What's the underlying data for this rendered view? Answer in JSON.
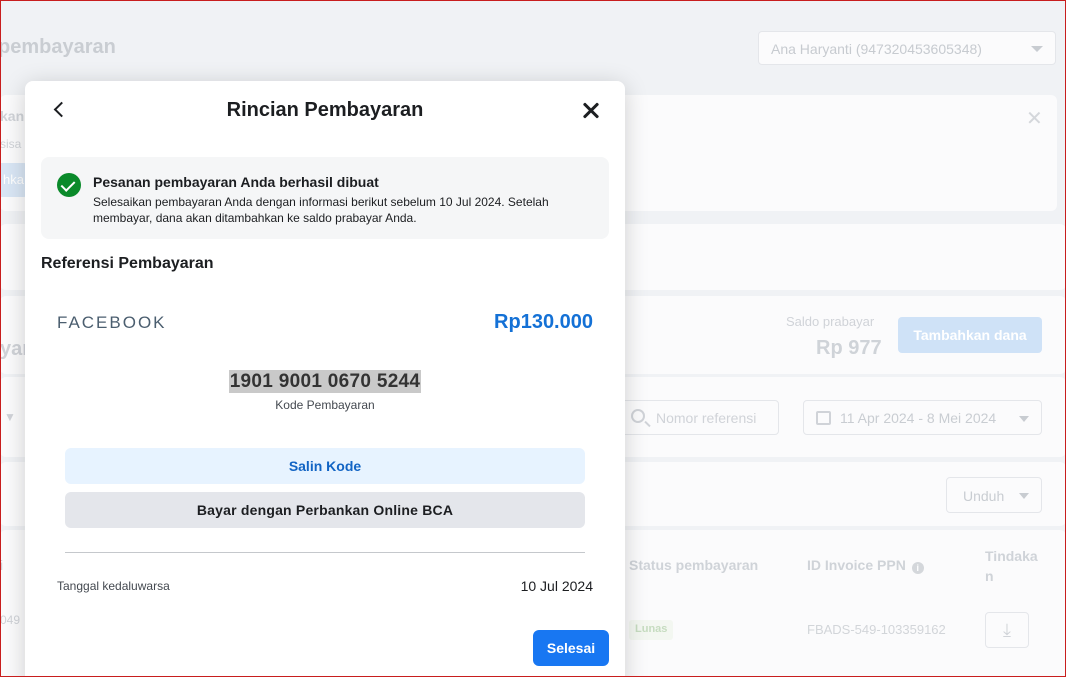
{
  "background": {
    "page_title": "pembayaran",
    "account_select": "Ana Haryanti (947320453605348)",
    "fragments": {
      "left1": "kan",
      "left2": "sisa",
      "left_btn": "hka",
      "left_heading": "yan"
    },
    "balance": {
      "label": "Saldo prabayar",
      "value": "Rp 977",
      "add_funds_label": "Tambahkan dana"
    },
    "search": {
      "placeholder": "Nomor referensi"
    },
    "date_range": "11 Apr 2024 - 8 Mei 2024",
    "download_label": "Unduh",
    "table": {
      "columns": [
        "Status pembayaran",
        "ID Invoice PPN",
        "Tindakan"
      ],
      "row": {
        "id_fragment": "049",
        "status": "Lunas",
        "invoice_id": "FBADS-549-103359162"
      }
    }
  },
  "modal": {
    "title": "Rincian Pembayaran",
    "success": {
      "title": "Pesanan pembayaran Anda berhasil dibuat",
      "message": "Selesaikan pembayaran Anda dengan informasi berikut sebelum 10 Jul 2024. Setelah membayar, dana akan ditambahkan ke saldo prabayar Anda."
    },
    "reference_heading": "Referensi Pembayaran",
    "brand": "FACEBOOK",
    "amount": "Rp130.000",
    "payment_code": "1901 9001 0670 5244",
    "payment_code_label": "Kode Pembayaran",
    "copy_button": "Salin Kode",
    "bank_button": "Bayar dengan Perbankan Online BCA",
    "expiry_label": "Tanggal kedaluwarsa",
    "expiry_value": "10 Jul 2024",
    "done_button": "Selesai"
  },
  "colors": {
    "accent": "#1877f2",
    "amount": "#1471d6",
    "success": "#0a8a2a"
  }
}
